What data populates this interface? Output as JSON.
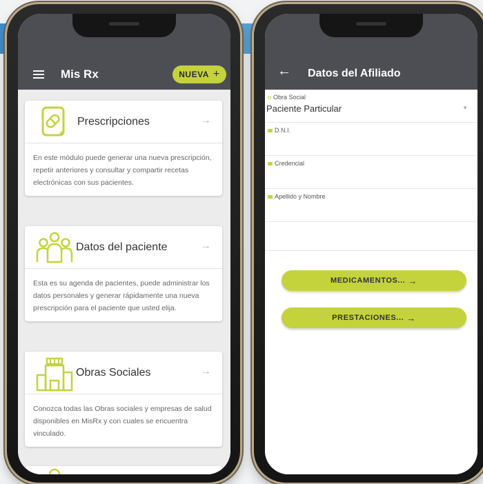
{
  "left_phone": {
    "app_title": "Mis Rx",
    "new_button": {
      "label": "NUEVA",
      "icon": "plus-icon"
    },
    "cards": [
      {
        "title": "Prescripciones",
        "icon": "prescription-icon",
        "body": "En este módulo puede generar una nueva prescripción, repetir anteriores y consultar y compartir recetas electrónicas con sus pacientes."
      },
      {
        "title": "Datos del paciente",
        "icon": "patients-icon",
        "body": "Esta es su agenda de pacientes, puede administrar los datos personales y generar rápidamente una nueva prescripción para el paciente que usted elija."
      },
      {
        "title": "Obras Sociales",
        "icon": "buildings-icon",
        "body": "Conozca todas las Obras sociales y empresas de salud disponibles en MisRx y con cuales se encuentra vinculado."
      }
    ]
  },
  "right_phone": {
    "app_title": "Datos del Afiliado",
    "fields": [
      {
        "label": "Obra Social",
        "value": "Paciente Particular"
      },
      {
        "label": "D.N.I.",
        "value": ""
      },
      {
        "label": "Credencial",
        "value": ""
      },
      {
        "label": "Apellido y Nombre",
        "value": ""
      }
    ],
    "buttons": [
      {
        "label": "MEDICAMENTOS..."
      },
      {
        "label": "PRESTACIONES..."
      }
    ]
  },
  "colors": {
    "accent": "#c4d33c",
    "appbar": "#4d4e54",
    "background_band": "#3d8fcf"
  }
}
